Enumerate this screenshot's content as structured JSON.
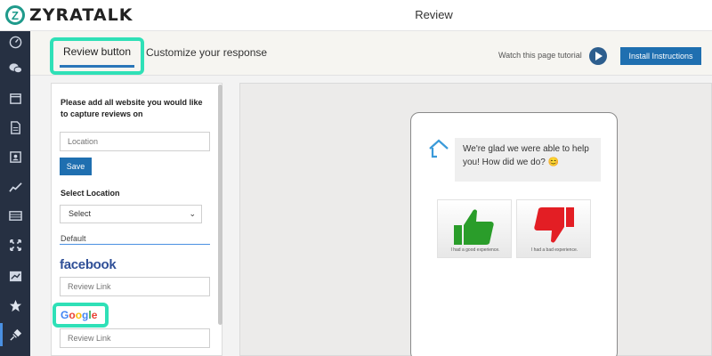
{
  "app": {
    "brand": "ZYRATALK",
    "logo_letter": "Z",
    "page_title": "Review"
  },
  "sidebar": {
    "icons": [
      "dashboard-icon",
      "chat-icon",
      "calendar-icon",
      "document-icon",
      "contacts-icon",
      "analytics-icon",
      "table-icon",
      "expand-icon",
      "reports-icon",
      "star-icon",
      "plug-icon"
    ],
    "active": "plug-icon"
  },
  "header": {
    "tabs": [
      {
        "label": "Review button",
        "active": true
      },
      {
        "label": "Customize your response",
        "active": false
      }
    ],
    "tutorial_text": "Watch this page tutorial",
    "install_label": "Install Instructions"
  },
  "form": {
    "instruction": "Please add all website you would like to capture reviews on",
    "location_placeholder": "Location",
    "save_label": "Save",
    "select_location_label": "Select Location",
    "select_value": "Select",
    "default_label": "Default",
    "facebook_label": "facebook",
    "facebook_link_placeholder": "Review Link",
    "google_label": "Google",
    "google_link_placeholder": "Review Link"
  },
  "preview": {
    "message": "We're glad we were able to help you! How did we do? 😊",
    "good_caption": "I had a good experience.",
    "bad_caption": "I had a bad experience."
  },
  "colors": {
    "accent": "#2fe0b7",
    "primary": "#1f6fb0",
    "sidebar": "#263042",
    "thumb_up": "#2a9d2a",
    "thumb_down": "#e31e24"
  }
}
